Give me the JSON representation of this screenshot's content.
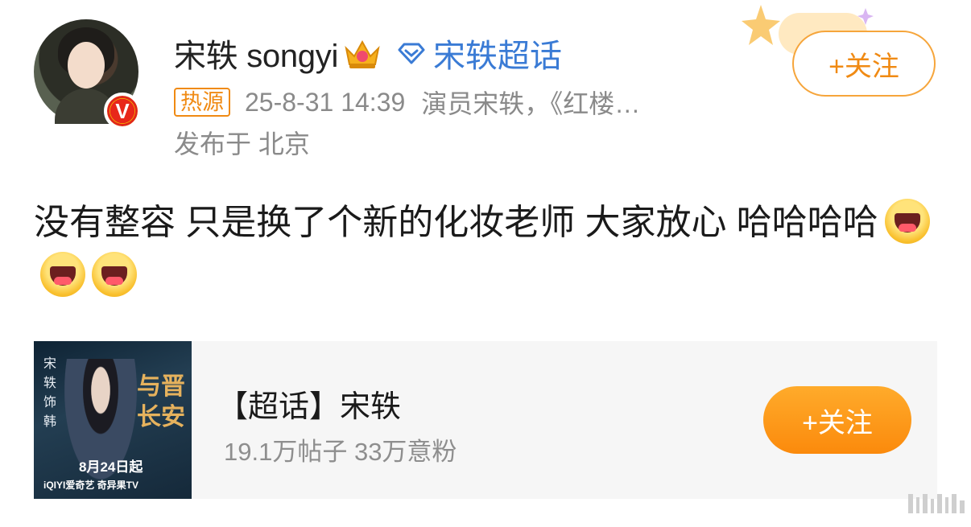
{
  "post": {
    "author": {
      "name": "宋轶 songyi",
      "supertopic_link": "宋轶超话",
      "verified": true
    },
    "source_badge": "热源",
    "timestamp": "25-8-31 14:39",
    "source_text": "演员宋轶，《红楼…",
    "location": "发布于 北京",
    "follow_label": "+关注",
    "text": "没有整容 只是换了个新的化妆老师 大家放心 哈哈哈哈",
    "emojis": [
      "laughing-emoji",
      "laughing-emoji",
      "laughing-emoji"
    ]
  },
  "topic_card": {
    "title": "【超话】宋轶",
    "stats": "19.1万帖子 33万意粉",
    "follow_label": "+关注",
    "cover": {
      "title": "与晋长安",
      "side_text": "宋轶 饰 韩",
      "date_text": "8月24日起",
      "logos": "iQIYI爱奇艺 奇异果TV"
    }
  },
  "colors": {
    "accent_orange": "#f08a13",
    "link_blue": "#3a7bd5",
    "meta_gray": "#8a8a8a"
  },
  "icons": {
    "crown": "crown-icon",
    "diamond": "diamond-icon",
    "verified": "verified-v-icon",
    "watermark": "weibo-watermark-icon"
  }
}
